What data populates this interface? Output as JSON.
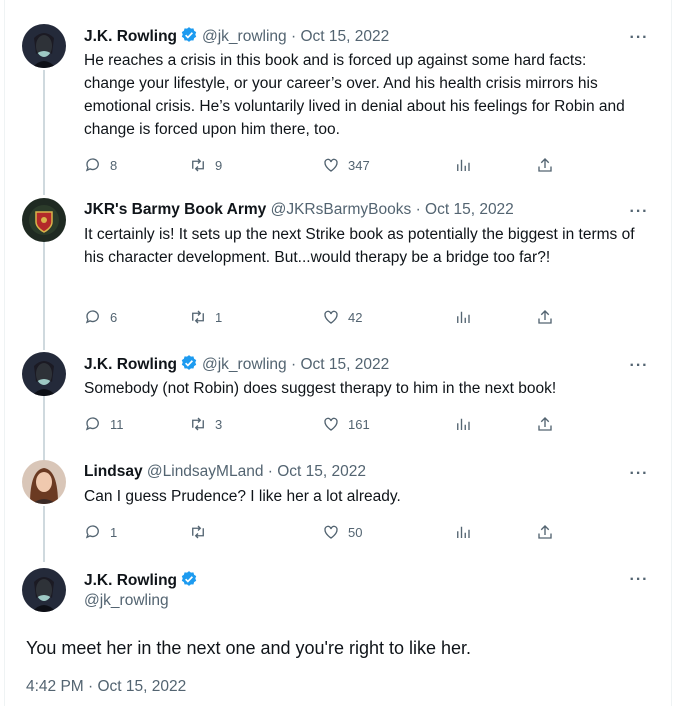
{
  "tweets": [
    {
      "name": "J.K. Rowling",
      "handle": "@jk_rowling",
      "date": "Oct 15, 2022",
      "text": "He reaches a crisis in this book and is forced up against some hard facts: change your lifestyle, or your career’s over. And his health crisis mirrors his emotional crisis. He’s voluntarily lived in denial about his feelings for Robin and change is forced upon him there, too.",
      "replies": "8",
      "retweets": "9",
      "likes": "347"
    },
    {
      "name": "JKR's Barmy Book Army",
      "handle": "@JKRsBarmyBooks",
      "date": "Oct 15, 2022",
      "text": "It certainly is! It sets up the next Strike book as potentially the biggest in terms of his character development. But...would therapy be a bridge too far?!",
      "replies": "6",
      "retweets": "1",
      "likes": "42"
    },
    {
      "name": "J.K. Rowling",
      "handle": "@jk_rowling",
      "date": "Oct 15, 2022",
      "text": "Somebody (not Robin) does suggest therapy to him in the next book!",
      "replies": "11",
      "retweets": "3",
      "likes": "161"
    },
    {
      "name": "Lindsay",
      "handle": "@LindsayMLand",
      "date": "Oct 15, 2022",
      "text": "Can I guess Prudence? I like her a lot already.",
      "replies": "1",
      "retweets": "",
      "likes": "50"
    }
  ],
  "main": {
    "name": "J.K. Rowling",
    "handle": "@jk_rowling",
    "text": "You meet her in the next one and you're right to like her.",
    "timestamp": "4:42 PM · Oct 15, 2022"
  },
  "separator": "·",
  "more_label": "···",
  "colors": {
    "verified": "#1d9bf0",
    "muted": "#536471",
    "text": "#0f1419",
    "thread_line": "#cfd9de"
  },
  "icons": [
    "reply-icon",
    "retweet-icon",
    "like-icon",
    "views-icon",
    "share-icon",
    "verified-badge-icon",
    "more-icon"
  ]
}
